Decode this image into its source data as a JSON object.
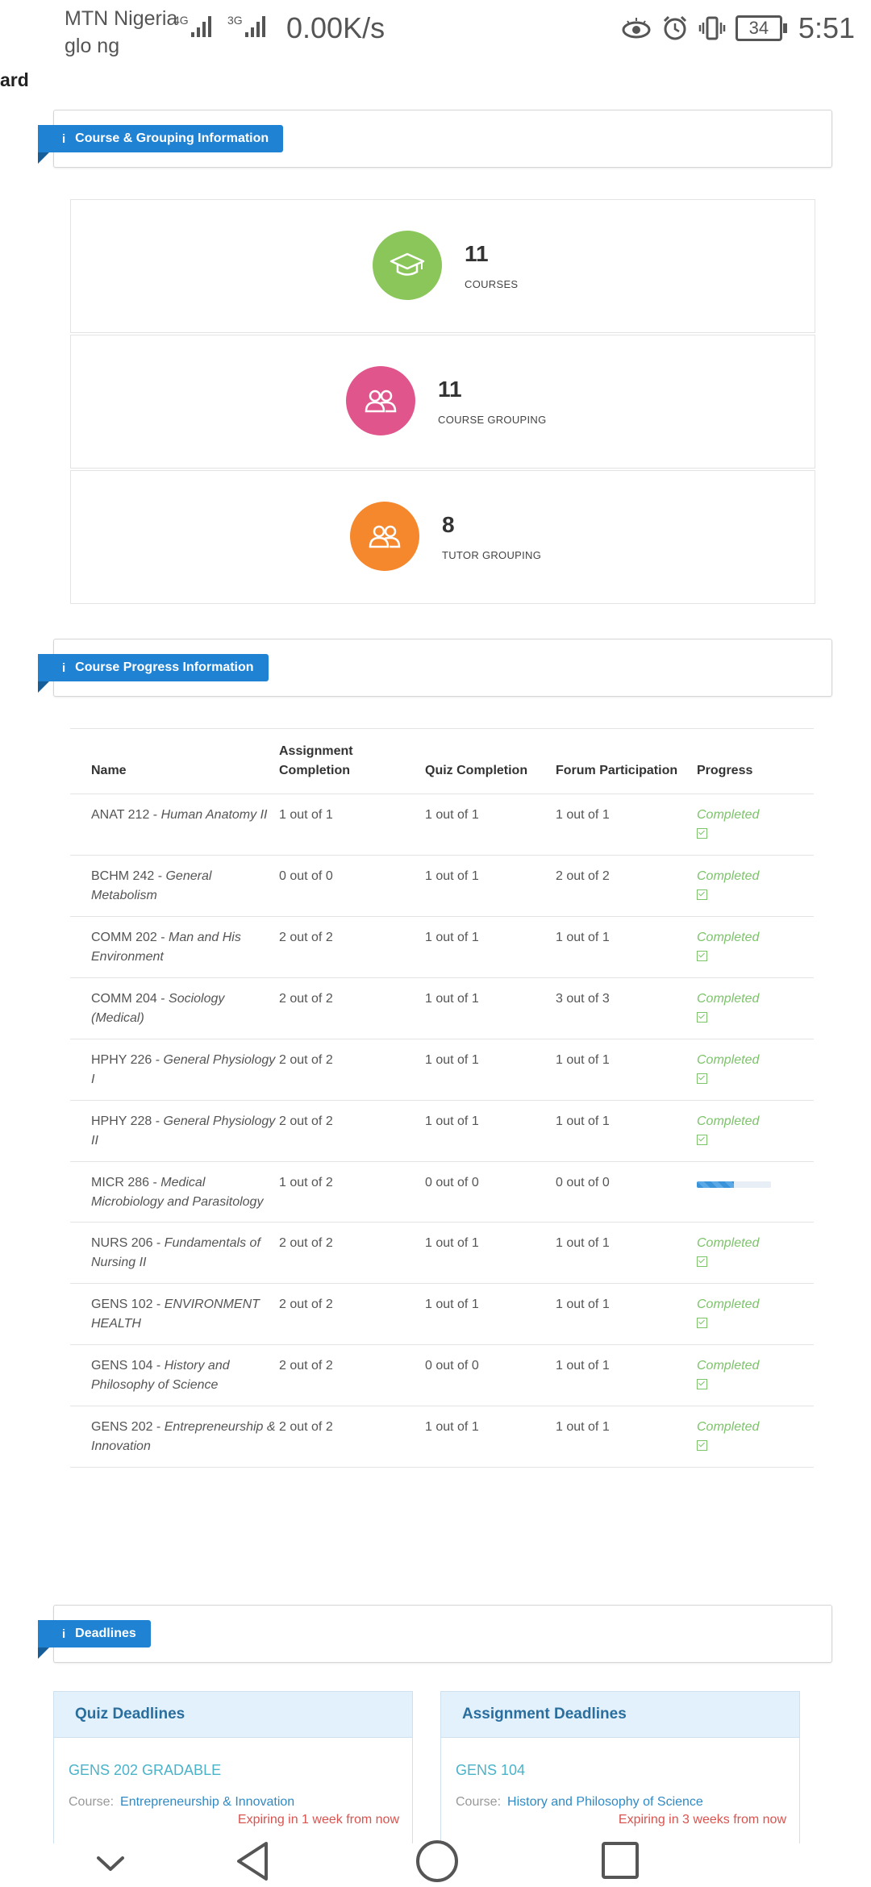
{
  "status_bar": {
    "carrier1": "MTN Nigeria",
    "carrier2": "glo ng",
    "net1": "4G",
    "net2": "3G",
    "speed": "0.00K/s",
    "battery": "34",
    "time": "5:51"
  },
  "page_fragment": "ard",
  "sections": {
    "course_grouping": "Course & Grouping Information",
    "course_progress": "Course Progress Information",
    "deadlines": "Deadlines"
  },
  "stats": [
    {
      "value": "11",
      "label": "COURSES",
      "color": "#8bc65a",
      "icon": "graduation-cap-icon"
    },
    {
      "value": "11",
      "label": "COURSE GROUPING",
      "color": "#e0558b",
      "icon": "users-icon"
    },
    {
      "value": "8",
      "label": "TUTOR GROUPING",
      "color": "#f5872d",
      "icon": "users-icon"
    }
  ],
  "table": {
    "headers": [
      "Name",
      "Assignment Completion",
      "Quiz Completion",
      "Forum Participation",
      "Progress"
    ],
    "rows": [
      {
        "code": "ANAT 212 - ",
        "name": "Human Anatomy II",
        "assignment": "1 out of 1",
        "quiz": "1 out of 1",
        "forum": "1 out of 1",
        "progress": "Completed"
      },
      {
        "code": "BCHM 242 - ",
        "name": "General Metabolism",
        "assignment": "0 out of 0",
        "quiz": "1 out of 1",
        "forum": "2 out of 2",
        "progress": "Completed"
      },
      {
        "code": "COMM 202 - ",
        "name": "Man and His Environment",
        "assignment": "2 out of 2",
        "quiz": "1 out of 1",
        "forum": "1 out of 1",
        "progress": "Completed"
      },
      {
        "code": "COMM 204 - ",
        "name": "Sociology (Medical)",
        "assignment": "2 out of 2",
        "quiz": "1 out of 1",
        "forum": "3 out of 3",
        "progress": "Completed"
      },
      {
        "code": "HPHY 226 - ",
        "name": "General Physiology I",
        "assignment": "2 out of 2",
        "quiz": "1 out of 1",
        "forum": "1 out of 1",
        "progress": "Completed"
      },
      {
        "code": "HPHY 228 - ",
        "name": "General Physiology II",
        "assignment": "2 out of 2",
        "quiz": "1 out of 1",
        "forum": "1 out of 1",
        "progress": "Completed"
      },
      {
        "code": "MICR 286 - ",
        "name": "Medical Microbiology and Parasitology",
        "assignment": "1 out of 2",
        "quiz": "0 out of 0",
        "forum": "0 out of 0",
        "progress": "",
        "progress_fraction": 0.5
      },
      {
        "code": "NURS 206 - ",
        "name": "Fundamentals of Nursing II",
        "assignment": "2 out of 2",
        "quiz": "1 out of 1",
        "forum": "1 out of 1",
        "progress": "Completed"
      },
      {
        "code": "GENS 102 - ",
        "name": "ENVIRONMENT HEALTH",
        "assignment": "2 out of 2",
        "quiz": "1 out of 1",
        "forum": "1 out of 1",
        "progress": "Completed"
      },
      {
        "code": "GENS 104 - ",
        "name": "History and Philosophy of Science",
        "assignment": "2 out of 2",
        "quiz": "0 out of 0",
        "forum": "1 out of 1",
        "progress": "Completed"
      },
      {
        "code": "GENS 202 - ",
        "name": "Entrepreneurship & Innovation",
        "assignment": "2 out of 2",
        "quiz": "1 out of 1",
        "forum": "1 out of 1",
        "progress": "Completed"
      }
    ]
  },
  "deadlines": {
    "quiz": {
      "header": "Quiz Deadlines",
      "title": "GENS 202 GRADABLE",
      "course_label": "Course:",
      "course": "Entrepreneurship & Innovation",
      "expiry": "Expiring in 1 week from now"
    },
    "assignment": {
      "header": "Assignment Deadlines",
      "title": "GENS 104",
      "course_label": "Course:",
      "course": "History and Philosophy of Science",
      "expiry": "Expiring in 3 weeks from now"
    }
  },
  "colors": {
    "ribbon": "#1f82d2",
    "completed": "#7cc36a",
    "expiry": "#d9534f"
  }
}
